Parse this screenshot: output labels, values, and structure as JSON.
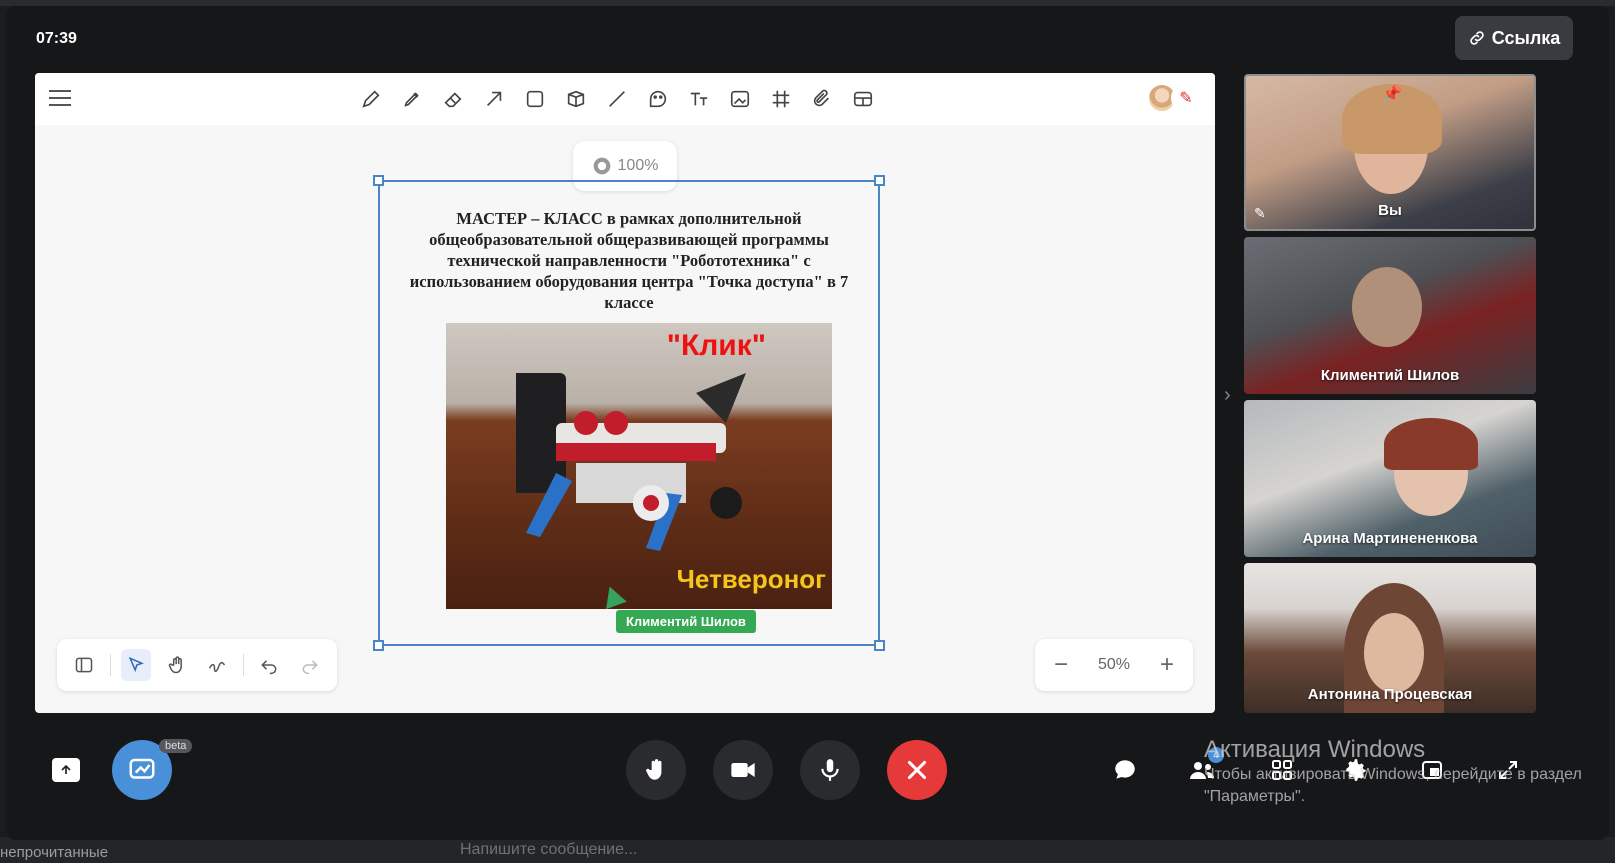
{
  "call": {
    "timer": "07:39",
    "link_label": "Ссылка"
  },
  "background": {
    "unread_label": "непрочитанные",
    "message_placeholder": "Напишите сообщение..."
  },
  "whiteboard": {
    "tools": [
      "pencil-icon",
      "marker-icon",
      "eraser-icon",
      "arrow-icon",
      "rectangle-icon",
      "cube-icon",
      "line-icon",
      "sticker-icon",
      "text-icon",
      "image-icon",
      "grid-icon",
      "attachment-icon",
      "table-icon"
    ],
    "object_zoom": "100%",
    "slide_title": "МАСТЕР – КЛАСС в рамках дополнительной общеобразовательной общеразвивающей программы технической направленности \"Робототехника\" с использованием оборудования центра \"Точка доступа\" в 7 классе",
    "photo_label_top": "\"Клик\"",
    "photo_label_bottom": "Четвероног",
    "cursor_user": "Климентий Шилов",
    "zoom_level": "50%",
    "colors": {
      "selection": "#4a86c5",
      "cursor_tag": "#34a853"
    }
  },
  "participants": [
    {
      "name": "Вы",
      "pinned": true
    },
    {
      "name": "Климентий Шилов"
    },
    {
      "name": "Арина Мартинененкова"
    },
    {
      "name": "Антонина Процевская"
    }
  ],
  "controls": {
    "beta_label": "beta",
    "people_count": "4",
    "colors": {
      "hangup": "#e5393a",
      "whiteboard": "#4a90d9"
    }
  },
  "activation": {
    "title": "Активация Windows",
    "line1": "Чтобы активировать Windows, перейдите в раздел",
    "line2": "\"Параметры\"."
  }
}
